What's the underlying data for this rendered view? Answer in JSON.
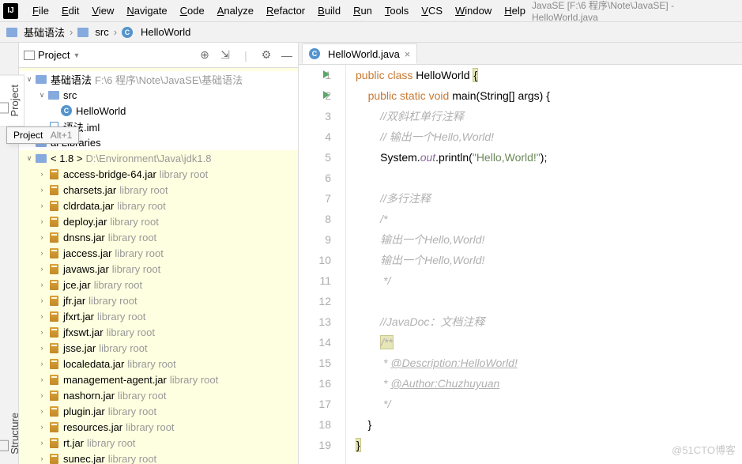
{
  "menu": [
    "File",
    "Edit",
    "View",
    "Navigate",
    "Code",
    "Analyze",
    "Refactor",
    "Build",
    "Run",
    "Tools",
    "VCS",
    "Window",
    "Help"
  ],
  "window_title": "JavaSE [F:\\6 程序\\Note\\JavaSE] - HelloWorld.java",
  "breadcrumb": {
    "module": "基础语法",
    "src": "src",
    "class": "HelloWorld"
  },
  "rails": {
    "project": "Project",
    "structure": "Structure"
  },
  "tooltip": {
    "label": "Project",
    "shortcut": "Alt+1"
  },
  "panel": {
    "title": "Project"
  },
  "tree": {
    "module": {
      "name": "基础语法",
      "path": "F:\\6 程序\\Note\\JavaSE\\基础语法"
    },
    "src": "src",
    "class": "HelloWorld",
    "iml": "语法.iml",
    "libs": "al Libraries",
    "jdk": {
      "name": "< 1.8 >",
      "path": "D:\\Environment\\Java\\jdk1.8"
    },
    "lib_suffix": "library root",
    "jars": [
      "access-bridge-64.jar",
      "charsets.jar",
      "cldrdata.jar",
      "deploy.jar",
      "dnsns.jar",
      "jaccess.jar",
      "javaws.jar",
      "jce.jar",
      "jfr.jar",
      "jfxrt.jar",
      "jfxswt.jar",
      "jsse.jar",
      "localedata.jar",
      "management-agent.jar",
      "nashorn.jar",
      "plugin.jar",
      "resources.jar",
      "rt.jar",
      "sunec.jar"
    ]
  },
  "editor": {
    "tab": "HelloWorld.java",
    "lines": [
      {
        "n": 1,
        "run": true,
        "tokens": [
          [
            "kw",
            "public"
          ],
          [
            "",
            " "
          ],
          [
            "kw",
            "class"
          ],
          [
            "",
            " HelloWorld "
          ],
          [
            "brace",
            "{"
          ]
        ]
      },
      {
        "n": 2,
        "run": true,
        "indent": 1,
        "tokens": [
          [
            "kw",
            "public"
          ],
          [
            "",
            " "
          ],
          [
            "kw",
            "static"
          ],
          [
            "",
            " "
          ],
          [
            "kw",
            "void"
          ],
          [
            "",
            " main(String[] args) {"
          ]
        ]
      },
      {
        "n": 3,
        "indent": 2,
        "tokens": [
          [
            "comment",
            "//双斜杠单行注释"
          ]
        ]
      },
      {
        "n": 4,
        "indent": 2,
        "tokens": [
          [
            "comment",
            "// 输出一个Hello,World!"
          ]
        ]
      },
      {
        "n": 5,
        "indent": 2,
        "tokens": [
          [
            "",
            "System."
          ],
          [
            "static-field",
            "out"
          ],
          [
            "",
            ".println("
          ],
          [
            "str",
            "\"Hello,World!\""
          ],
          [
            "",
            ");"
          ]
        ]
      },
      {
        "n": 6,
        "indent": 2,
        "tokens": []
      },
      {
        "n": 7,
        "indent": 2,
        "tokens": [
          [
            "comment",
            "//多行注释"
          ]
        ]
      },
      {
        "n": 8,
        "indent": 2,
        "tokens": [
          [
            "comment",
            "/*"
          ]
        ]
      },
      {
        "n": 9,
        "indent": 2,
        "tokens": [
          [
            "comment",
            "输出一个Hello,World!"
          ]
        ]
      },
      {
        "n": 10,
        "indent": 2,
        "tokens": [
          [
            "comment",
            "输出一个Hello,World!"
          ]
        ]
      },
      {
        "n": 11,
        "indent": 2,
        "tokens": [
          [
            "comment",
            " */"
          ]
        ]
      },
      {
        "n": 12,
        "indent": 2,
        "tokens": []
      },
      {
        "n": 13,
        "indent": 2,
        "tokens": [
          [
            "comment",
            "//JavaDoc：文档注释"
          ]
        ]
      },
      {
        "n": 14,
        "indent": 2,
        "tokens": [
          [
            "doc-hl",
            "/**"
          ]
        ]
      },
      {
        "n": 15,
        "indent": 2,
        "tokens": [
          [
            "doc",
            " * "
          ],
          [
            "doc-u",
            "@Description:HelloWorld!"
          ]
        ]
      },
      {
        "n": 16,
        "indent": 2,
        "tokens": [
          [
            "doc",
            " * "
          ],
          [
            "doc-u",
            "@Author:Chuzhuyuan"
          ]
        ]
      },
      {
        "n": 17,
        "indent": 2,
        "tokens": [
          [
            "doc",
            " */"
          ]
        ]
      },
      {
        "n": 18,
        "indent": 1,
        "tokens": [
          [
            "",
            "}"
          ]
        ]
      },
      {
        "n": 19,
        "indent": 0,
        "tokens": [
          [
            "brace",
            "}"
          ]
        ]
      }
    ]
  },
  "watermark": "@51CTO博客"
}
